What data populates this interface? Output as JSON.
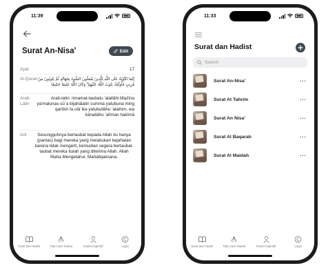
{
  "left_screen": {
    "status": {
      "time": "11:39"
    },
    "title": "Surat An-Nisa'",
    "edit_label": "Edit",
    "rows": {
      "ayat": {
        "label": "Ayat",
        "value": "17"
      },
      "al_quran": {
        "label": "Al-Quran",
        "value": "إِنَّمَا التَّوْبَةُ عَلَى اللَّهِ لِلَّذِينَ يَعْمَلُونَ السُّوءَ بِجَهَالَةٍ ثُمَّ يَتُوبُونَ مِنْ قَرِيبٍ فَأُولَٰئِكَ يَتُوبُ اللَّهُ عَلَيْهِمْ ۗ وَكَانَ اللَّهُ عَلِيمًا حَكِيمًا"
      },
      "arab_latin": {
        "label": "Arab-Latin",
        "value": "Arab-latin: innamat-taubatu 'alallāhi lillażīna ya'malụnas-sū`a bijahālatin ṡumma yatụbụna ming qarībin fa ulā`ika yatụbullāhu 'alaihim, wa kānallāhu 'alīman ḥakīmā"
      },
      "arti": {
        "label": "Arti",
        "value": "Sesungguhnya bertaubat kepada Allah itu hanya (pantas) bagi mereka yang melakukan kejahatan karena tidak mengerti, kemudian segera bertaubat. taubat mereka itulah yang diterima Allah. Allah Maha Mengetahui, Mahabijaksana."
      }
    }
  },
  "right_screen": {
    "status": {
      "time": "11:33"
    },
    "title": "Surat dan Hadist",
    "search_placeholder": "Search",
    "items": [
      {
        "name": "Surat An-Nisa'"
      },
      {
        "name": "Surat At Tahrim"
      },
      {
        "name": "Surat An Nisa'"
      },
      {
        "name": "Surat Al Baqarah"
      },
      {
        "name": "Surat Al Maidah"
      }
    ],
    "more_label": "···"
  },
  "nav": [
    {
      "label": "Surat dan Hadist",
      "icon": "book-open-icon"
    },
    {
      "label": "Tata Cara Taubat",
      "icon": "hands-pray-icon"
    },
    {
      "label": "Kisah Inspiratif",
      "icon": "person-icon"
    },
    {
      "label": "Login",
      "icon": "copyright-icon"
    }
  ],
  "colors": {
    "accent": "#3f4a52",
    "frame": "#1c1c1e",
    "search_bg": "#efeff1"
  }
}
